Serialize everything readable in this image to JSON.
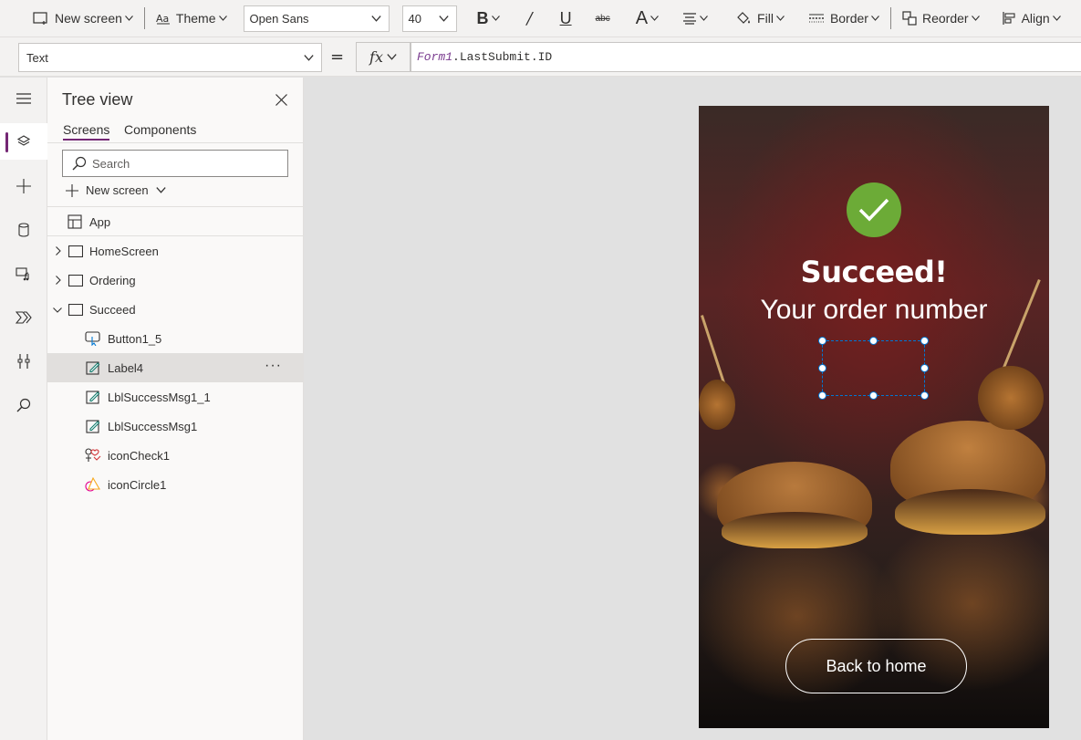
{
  "toolbar": {
    "new_screen": "New screen",
    "theme": "Theme",
    "font": "Open Sans",
    "font_size": "40",
    "fill": "Fill",
    "border": "Border",
    "reorder": "Reorder",
    "align": "Align",
    "strike_glyph": "abc"
  },
  "formula": {
    "property": "Text",
    "equals": "=",
    "fx": "fx",
    "object": "Form1",
    "rest": ".LastSubmit.ID"
  },
  "tree": {
    "title": "Tree view",
    "tabs": [
      "Screens",
      "Components"
    ],
    "search_placeholder": "Search",
    "new_screen": "New screen",
    "app": "App",
    "screens": [
      "HomeScreen",
      "Ordering",
      "Succeed"
    ],
    "controls": [
      "Button1_5",
      "Label4",
      "LblSuccessMsg1_1",
      "LblSuccessMsg1",
      "iconCheck1",
      "iconCircle1"
    ],
    "more": "···"
  },
  "canvas": {
    "title": "Succeed!",
    "subtitle": "Your order number",
    "button": "Back to home"
  },
  "colors": {
    "accent": "#742774",
    "check": "#6cab37",
    "selection": "#0078d4"
  }
}
